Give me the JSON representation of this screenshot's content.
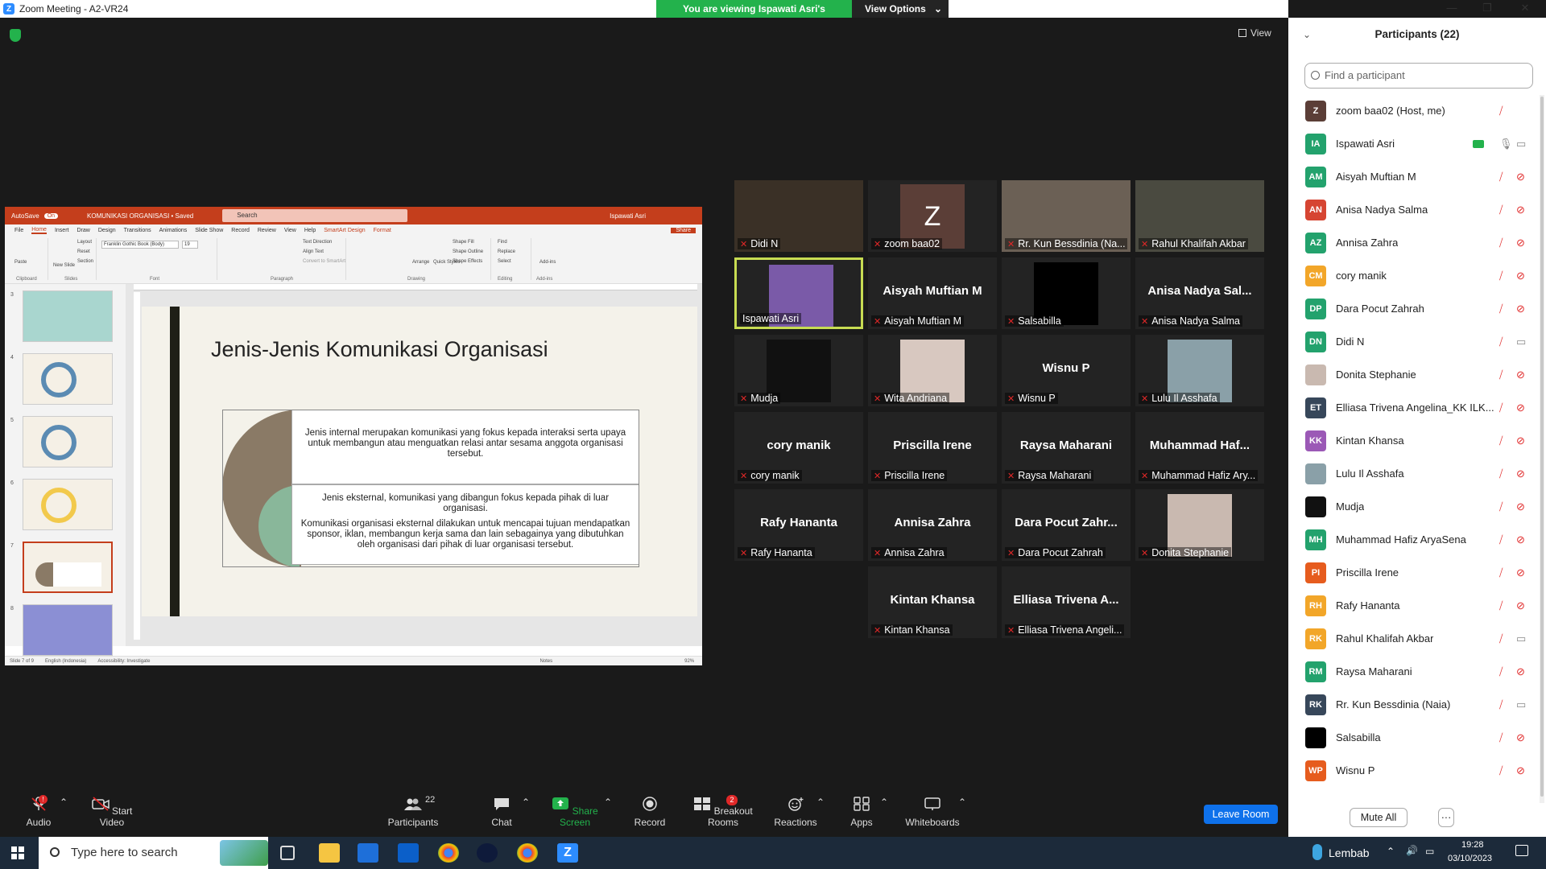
{
  "window": {
    "title": "Zoom Meeting - A2-VR24",
    "viewing_banner": "You are viewing Ispawati Asri's screen",
    "view_options": "View Options",
    "view_label": "View"
  },
  "ppt": {
    "autosave": "AutoSave",
    "autosave_state": "On",
    "doc_title": "KOMUNIKASI ORGANISASI • Saved",
    "search": "Search",
    "user": "Ispawati Asri",
    "menu": [
      "File",
      "Home",
      "Insert",
      "Draw",
      "Design",
      "Transitions",
      "Animations",
      "Slide Show",
      "Record",
      "Review",
      "View",
      "Help",
      "SmartArt Design",
      "Format"
    ],
    "share": "Share",
    "ribbon": {
      "font_name": "Franklin Gothic Book (Body)",
      "font_size": "19",
      "paste": "Paste",
      "new_slide": "New Slide",
      "layout": "Layout",
      "reset": "Reset",
      "section": "Section",
      "text_direction": "Text Direction",
      "align_text": "Align Text",
      "convert": "Convert to SmartArt",
      "arrange": "Arrange",
      "quick_styles": "Quick Styles",
      "shape_fill": "Shape Fill",
      "shape_outline": "Shape Outline",
      "shape_effects": "Shape Effects",
      "find": "Find",
      "replace": "Replace",
      "select": "Select",
      "addins": "Add-ins",
      "groups": [
        "Clipboard",
        "Slides",
        "Font",
        "Paragraph",
        "Drawing",
        "Editing",
        "Add-ins"
      ]
    },
    "thumb_numbers": [
      "3",
      "4",
      "5",
      "6",
      "7",
      "8"
    ],
    "slide_title": "Jenis-Jenis Komunikasi Organisasi",
    "box1_text": "Jenis internal merupakan komunikasi yang fokus kepada interaksi serta upaya untuk membangun atau menguatkan relasi antar sesama anggota organisasi tersebut.",
    "box2_p1": "Jenis eksternal, komunikasi yang dibangun fokus kepada pihak di luar organisasi.",
    "box2_p2": "Komunikasi organisasi eksternal dilakukan untuk mencapai tujuan mendapatkan sponsor, iklan, membangun kerja sama dan lain sebagainya yang dibutuhkan oleh organisasi dari pihak di luar organisasi tersebut.",
    "status": {
      "slide": "Slide 7 of 9",
      "language": "English (Indonesia)",
      "accessibility": "Accessibility: Investigate",
      "notes": "Notes",
      "zoom": "92%"
    }
  },
  "tiles": [
    {
      "big": "",
      "label": "Didi N",
      "photo": true,
      "color": "#3a3026"
    },
    {
      "big": "",
      "label": "zoom baa02",
      "photo": false,
      "zbox": "Z"
    },
    {
      "big": "",
      "label": "Rr. Kun Bessdinia (Na...",
      "photo": true,
      "color": "#6b6055"
    },
    {
      "big": "",
      "label": "Rahul Khalifah Akbar",
      "photo": true,
      "color": "#4a4a40"
    },
    {
      "big": "",
      "label": "Ispawati Asri",
      "photo": true,
      "color": "#7a5aa8"
    },
    {
      "big": "Aisyah Muftian M",
      "label": "Aisyah Muftian M"
    },
    {
      "big": "",
      "label": "Salsabilla",
      "black": true
    },
    {
      "big": "Anisa Nadya Sal...",
      "label": "Anisa Nadya Salma"
    },
    {
      "big": "",
      "label": "Mudja",
      "photo": true,
      "color": "#111"
    },
    {
      "big": "",
      "label": "Wita Andriana",
      "photo": true,
      "color": "#d8c8c0"
    },
    {
      "big": "Wisnu P",
      "label": "Wisnu P"
    },
    {
      "big": "",
      "label": "Lulu Il Asshafa",
      "photo": true,
      "color": "#8aa0a8"
    },
    {
      "big": "cory manik",
      "label": "cory manik"
    },
    {
      "big": "Priscilla Irene",
      "label": "Priscilla Irene"
    },
    {
      "big": "Raysa Maharani",
      "label": "Raysa Maharani"
    },
    {
      "big": "Muhammad Haf...",
      "label": "Muhammad Hafiz Ary..."
    },
    {
      "big": "Rafy Hananta",
      "label": "Rafy Hananta"
    },
    {
      "big": "Annisa Zahra",
      "label": "Annisa Zahra"
    },
    {
      "big": "Dara Pocut Zahr...",
      "label": "Dara Pocut Zahrah"
    },
    {
      "big": "",
      "label": "Donita Stephanie",
      "photo": true,
      "color": "#c9b9b0"
    },
    {
      "big": "Kintan Khansa",
      "label": "Kintan Khansa"
    },
    {
      "big": "Elliasa Trivena A...",
      "label": "Elliasa Trivena Angeli..."
    }
  ],
  "panel": {
    "title": "Participants (22)",
    "find_placeholder": "Find a participant",
    "mute_all": "Mute All",
    "more": "···",
    "participants": [
      {
        "initials": "Z",
        "name": "zoom baa02 (Host, me)",
        "color": "#5b3e37",
        "cam": false,
        "mic": "muted"
      },
      {
        "initials": "IA",
        "name": "Ispawati Asri",
        "color": "#23a26d",
        "cam": "video",
        "mic": "on",
        "share": true
      },
      {
        "initials": "AM",
        "name": "Aisyah Muftian M",
        "color": "#23a26d",
        "mic": "muted"
      },
      {
        "initials": "AN",
        "name": "Anisa Nadya Salma",
        "color": "#d64532",
        "mic": "muted"
      },
      {
        "initials": "AZ",
        "name": "Annisa Zahra",
        "color": "#23a26d",
        "mic": "muted"
      },
      {
        "initials": "CM",
        "name": "cory manik",
        "color": "#f2a629",
        "mic": "muted"
      },
      {
        "initials": "DP",
        "name": "Dara Pocut Zahrah",
        "color": "#23a26d",
        "mic": "muted"
      },
      {
        "initials": "DN",
        "name": "Didi N",
        "color": "#23a26d",
        "mic": "muted",
        "cam": "video"
      },
      {
        "initials": "",
        "name": "Donita Stephanie",
        "color": "#c9b9b0",
        "mic": "muted"
      },
      {
        "initials": "ET",
        "name": "Elliasa Trivena Angelina_KK ILK...",
        "color": "#37475a",
        "mic": "muted"
      },
      {
        "initials": "KK",
        "name": "Kintan Khansa",
        "color": "#9b59b6",
        "mic": "muted"
      },
      {
        "initials": "",
        "name": "Lulu Il Asshafa",
        "color": "#8aa0a8",
        "mic": "muted"
      },
      {
        "initials": "",
        "name": "Mudja",
        "color": "#111",
        "mic": "muted"
      },
      {
        "initials": "MH",
        "name": "Muhammad Hafiz AryaSena",
        "color": "#23a26d",
        "mic": "muted"
      },
      {
        "initials": "PI",
        "name": "Priscilla Irene",
        "color": "#e65c1e",
        "mic": "muted"
      },
      {
        "initials": "RH",
        "name": "Rafy Hananta",
        "color": "#f2a629",
        "mic": "muted"
      },
      {
        "initials": "RK",
        "name": "Rahul Khalifah Akbar",
        "color": "#f2a629",
        "mic": "muted",
        "cam": "video"
      },
      {
        "initials": "RM",
        "name": "Raysa Maharani",
        "color": "#23a26d",
        "mic": "muted"
      },
      {
        "initials": "RK",
        "name": "Rr. Kun Bessdinia (Naia)",
        "color": "#37475a",
        "mic": "muted",
        "cam": "video"
      },
      {
        "initials": "",
        "name": "Salsabilla",
        "color": "#000",
        "mic": "muted"
      },
      {
        "initials": "WP",
        "name": "Wisnu P",
        "color": "#e65c1e",
        "mic": "muted"
      }
    ]
  },
  "toolbar": {
    "audio": "Audio",
    "start_video": "Start Video",
    "participants": "Participants",
    "participants_count": "22",
    "chat": "Chat",
    "share_screen": "Share Screen",
    "record": "Record",
    "breakout": "Breakout Rooms",
    "breakout_badge": "2",
    "reactions": "Reactions",
    "apps": "Apps",
    "whiteboards": "Whiteboards",
    "leave": "Leave Room",
    "audio_badge": "!"
  },
  "taskbar": {
    "search": "Type here to search",
    "weather": "Lembab",
    "time": "19:28",
    "date": "03/10/2023"
  },
  "colors": {
    "zoom_blue": "#2D8CFF",
    "green": "#23b24c",
    "ppt_red": "#c43e1c",
    "mute_red": "#e02828",
    "active_border": "#c7dc52"
  }
}
